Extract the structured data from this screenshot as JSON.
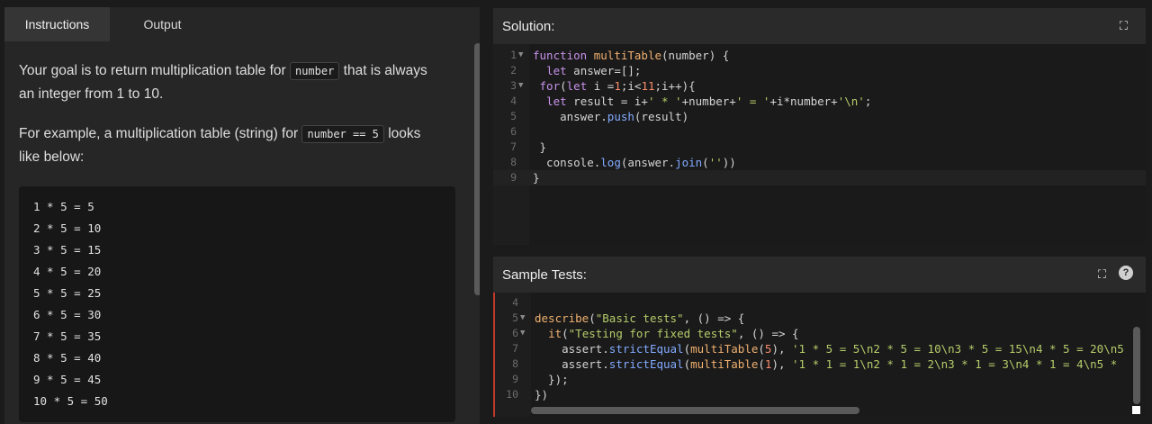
{
  "tabs": {
    "instructions": "Instructions",
    "output": "Output"
  },
  "instructions": {
    "para1_pre": "Your goal is to return multiplication table for ",
    "para1_code": "number",
    "para1_post": " that is always an integer from 1 to 10.",
    "para2_pre": "For example, a multiplication table (string) for ",
    "para2_code": "number == 5",
    "para2_post": " looks like below:",
    "example_lines": [
      "1 * 5 = 5",
      "2 * 5 = 10",
      "3 * 5 = 15",
      "4 * 5 = 20",
      "5 * 5 = 25",
      "6 * 5 = 30",
      "7 * 5 = 35",
      "8 * 5 = 40",
      "9 * 5 = 45",
      "10 * 5 = 50"
    ]
  },
  "solution": {
    "title": "Solution:",
    "lines": [
      {
        "n": "1",
        "fold": true,
        "text": "function multiTable(number) {"
      },
      {
        "n": "2",
        "fold": false,
        "text": "  let answer=[];"
      },
      {
        "n": "3",
        "fold": true,
        "text": " for(let i =1;i<11;i++){"
      },
      {
        "n": "4",
        "fold": false,
        "text": "  let result = i+' * '+number+' = '+i*number+'\\n';"
      },
      {
        "n": "5",
        "fold": false,
        "text": "    answer.push(result)"
      },
      {
        "n": "6",
        "fold": false,
        "text": ""
      },
      {
        "n": "7",
        "fold": false,
        "text": " }"
      },
      {
        "n": "8",
        "fold": false,
        "text": "  console.log(answer.join(''))"
      },
      {
        "n": "9",
        "fold": false,
        "text": "}"
      }
    ]
  },
  "tests": {
    "title": "Sample Tests:",
    "help": "?",
    "lines": [
      {
        "n": "4",
        "fold": false,
        "text": ""
      },
      {
        "n": "5",
        "fold": true,
        "text": "describe(\"Basic tests\", () => {"
      },
      {
        "n": "6",
        "fold": true,
        "text": "  it(\"Testing for fixed tests\", () => {"
      },
      {
        "n": "7",
        "fold": false,
        "text": "    assert.strictEqual(multiTable(5), '1 * 5 = 5\\n2 * 5 = 10\\n3 * 5 = 15\\n4 * 5 = 20\\n5"
      },
      {
        "n": "8",
        "fold": false,
        "text": "    assert.strictEqual(multiTable(1), '1 * 1 = 1\\n2 * 1 = 2\\n3 * 1 = 3\\n4 * 1 = 4\\n5 *"
      },
      {
        "n": "9",
        "fold": false,
        "text": "  });"
      },
      {
        "n": "10",
        "fold": false,
        "text": "})"
      }
    ]
  }
}
